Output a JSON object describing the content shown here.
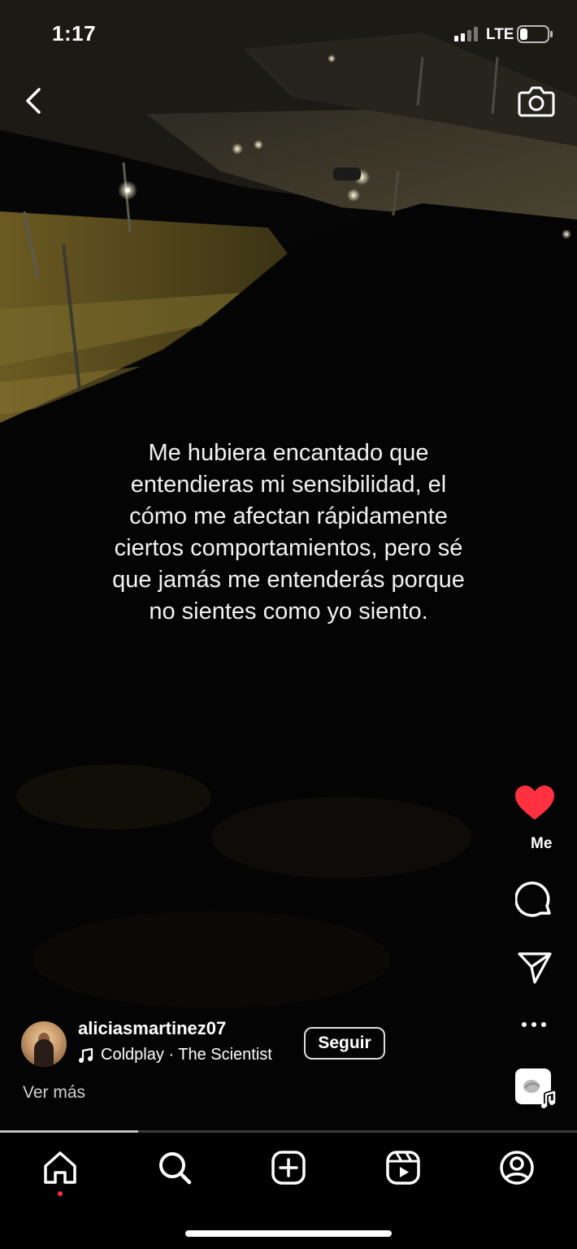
{
  "status_bar": {
    "time": "1:17",
    "network": "LTE"
  },
  "top_bar": {
    "back_icon": "chevron-left-icon",
    "camera_icon": "camera-icon"
  },
  "reel": {
    "caption": "Me hubiera encantado que entendieras mi sensibilidad, el cómo me afectan rápidamente ciertos comportamientos, pero sé que jamás me entenderás porque no sientes como yo siento.",
    "progress": 0.24
  },
  "actions": {
    "like_label": "Me",
    "like_color": "#ff3040",
    "like_icon": "heart-filled-icon",
    "comment_icon": "comment-icon",
    "share_icon": "paper-plane-icon",
    "more_icon": "more-horizontal-icon",
    "audio_icon": "audio-thumbnail-icon"
  },
  "author": {
    "username": "aliciasmartinez07",
    "music": "Coldplay · The Scientist",
    "follow_label": "Seguir",
    "see_more": "Ver más"
  },
  "nav": {
    "items": [
      "home-icon",
      "search-icon",
      "create-icon",
      "reels-icon",
      "profile-icon"
    ],
    "notification_color": "#ff2d3a"
  }
}
